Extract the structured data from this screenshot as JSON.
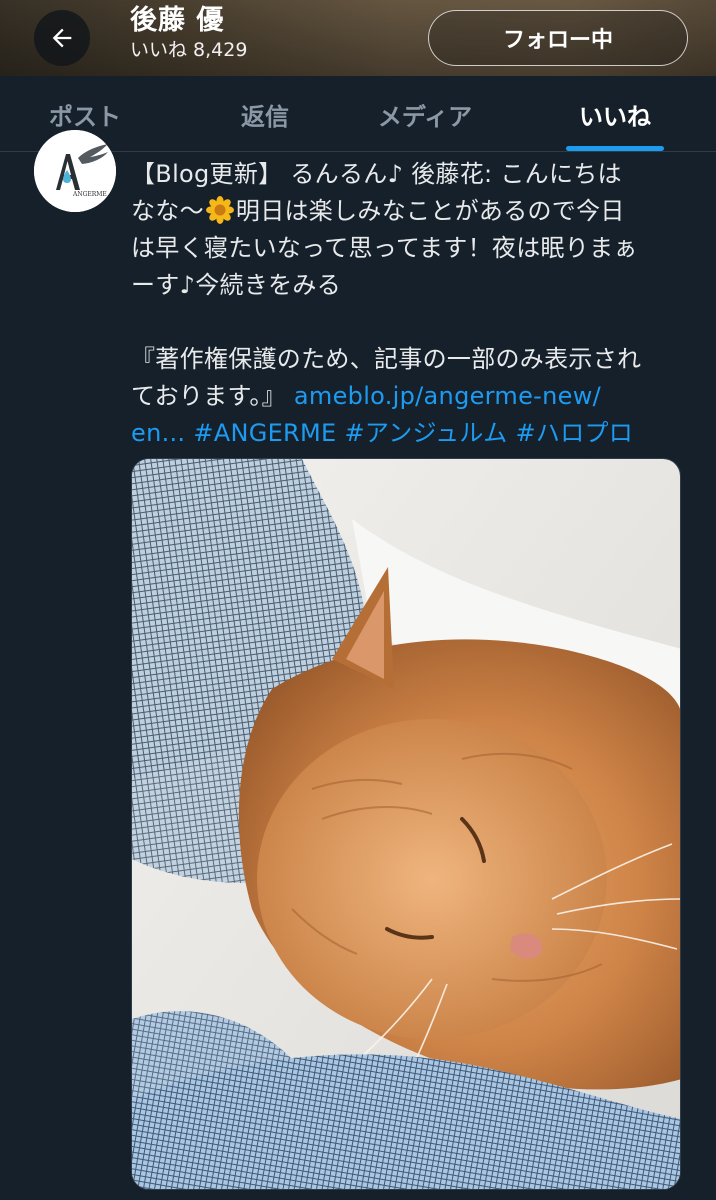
{
  "header": {
    "display_name": "後藤 優",
    "likes_label": "いいね 8,429",
    "follow_button": "フォロー中"
  },
  "tabs": [
    {
      "label": "ポスト",
      "active": false
    },
    {
      "label": "返信",
      "active": false
    },
    {
      "label": "メディア",
      "active": false
    },
    {
      "label": "いいね",
      "active": true
    }
  ],
  "tweet": {
    "line1": "【Blog更新】 るんるん♪ 後藤花: こんにちは",
    "line2_before": "なな〜",
    "line2_emoji": "flower-emoji",
    "line2_after": "明日は楽しみなことがあるので今日",
    "line3": "は早く寝たいなって思ってます！夜は眠りまぁ",
    "line4": "ーす♪今続きをみる",
    "line5": "『著作権保護のため、記事の一部のみ表示され",
    "line6_text": "ております。』 ",
    "line6_link": "ameblo.jp/angerme-new/",
    "line7_link": "en...",
    "hashtags": [
      "#ANGERME",
      "#アンジュルム",
      "#ハロプロ"
    ]
  },
  "avatar": {
    "logo_text": "ANGERME"
  },
  "media": {
    "description_icon": "cat-photo"
  },
  "colors": {
    "background": "#15202b",
    "accent": "#1d9bf0",
    "text": "#e7e9ea",
    "muted": "#8b98a5"
  }
}
